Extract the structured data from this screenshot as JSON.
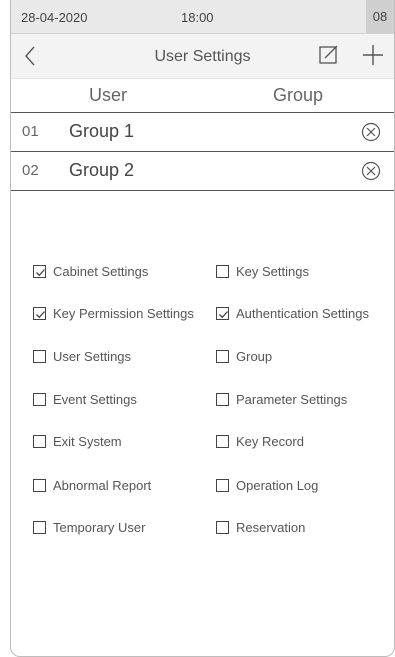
{
  "status": {
    "date": "28-04-2020",
    "time": "18:00",
    "badge": "08"
  },
  "nav": {
    "title": "User Settings"
  },
  "columns": {
    "user": "User",
    "group": "Group"
  },
  "groups": [
    {
      "index": "01",
      "name": "Group 1"
    },
    {
      "index": "02",
      "name": "Group 2"
    }
  ],
  "permissions": [
    {
      "label": "Cabinet Settings",
      "checked": true
    },
    {
      "label": "Key Settings",
      "checked": false
    },
    {
      "label": "Key Permission Settings",
      "checked": true
    },
    {
      "label": "Authentication Settings",
      "checked": true
    },
    {
      "label": "User Settings",
      "checked": false
    },
    {
      "label": "Group",
      "checked": false
    },
    {
      "label": "Event Settings",
      "checked": false
    },
    {
      "label": "Parameter Settings",
      "checked": false
    },
    {
      "label": "Exit System",
      "checked": false
    },
    {
      "label": "Key Record",
      "checked": false
    },
    {
      "label": "Abnormal Report",
      "checked": false
    },
    {
      "label": "Operation Log",
      "checked": false
    },
    {
      "label": "Temporary User",
      "checked": false
    },
    {
      "label": "Reservation",
      "checked": false
    }
  ]
}
